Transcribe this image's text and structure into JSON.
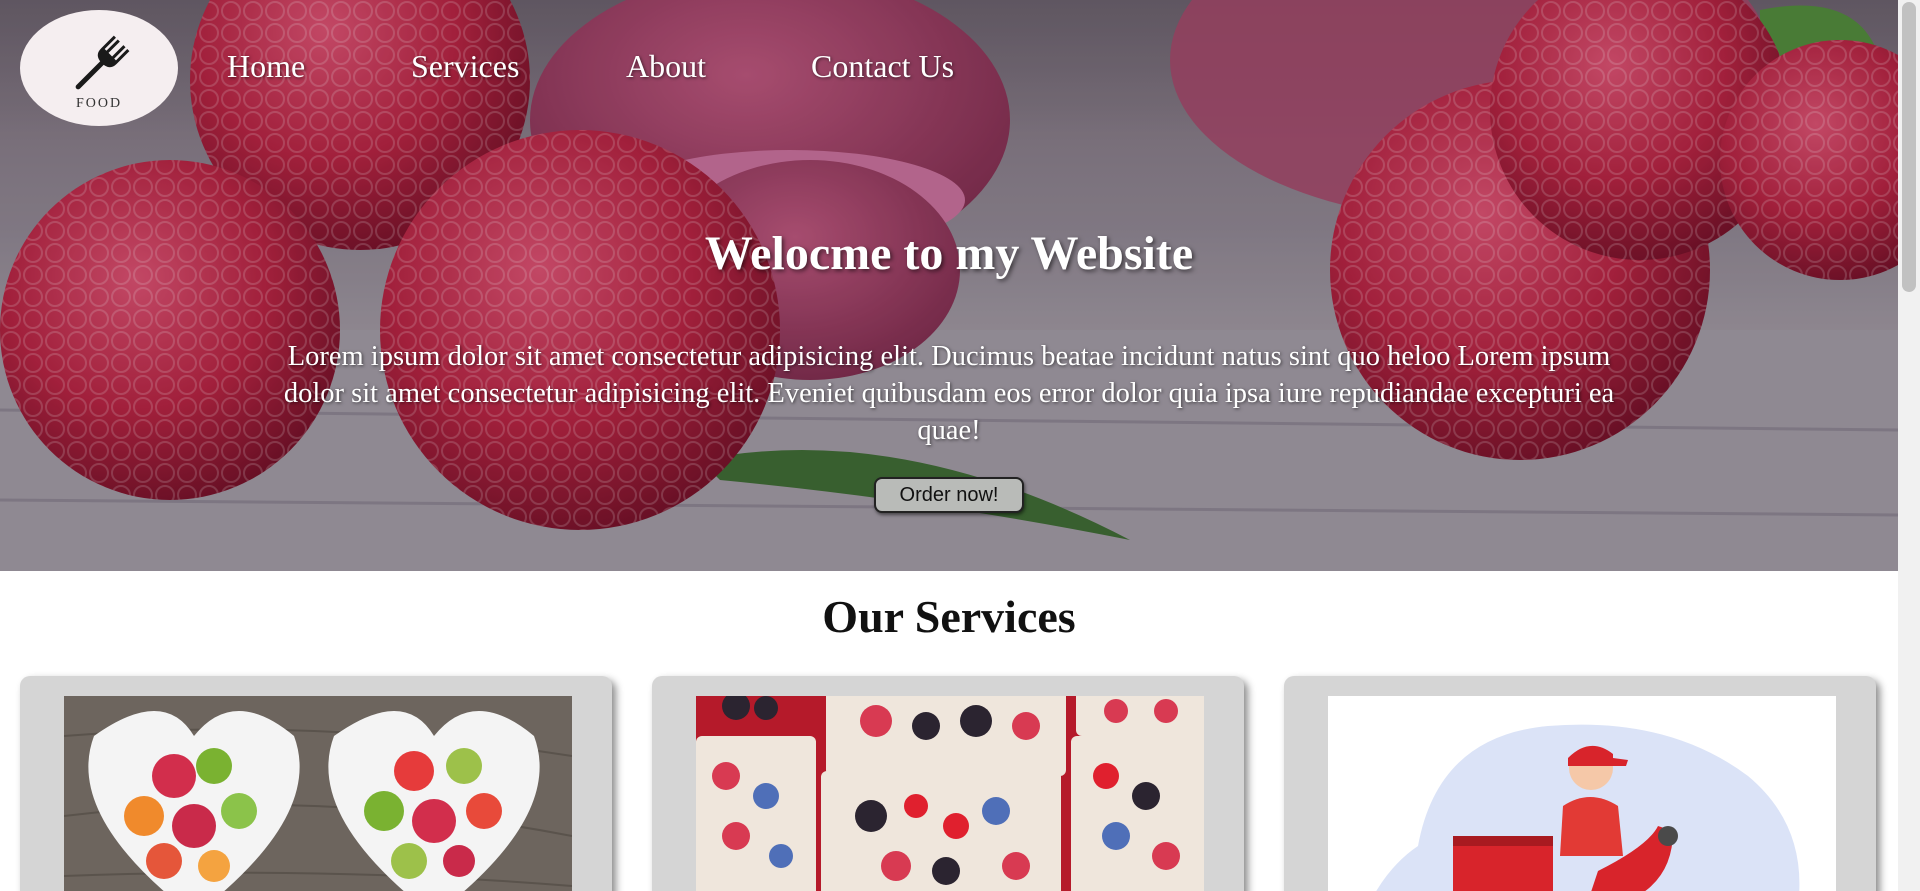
{
  "logo": {
    "text": "FOOD",
    "icon": "fork-icon"
  },
  "nav": {
    "items": [
      {
        "label": "Home"
      },
      {
        "label": "Services"
      },
      {
        "label": "About"
      },
      {
        "label": "Contact Us"
      }
    ]
  },
  "hero": {
    "title": "Welocme to my Website",
    "text": "Lorem ipsum dolor sit amet consectetur adipisicing elit. Ducimus beatae incidunt natus sint quo heloo Lorem ipsum dolor sit amet consectetur adipisicing elit. Eveniet quibusdam eos error dolor quia ipsa iure repudiandae excepturi ea quae!",
    "button_label": "Order now!"
  },
  "services": {
    "title": "Our Services",
    "cards": [
      {
        "image": "fruit-salad-bowls-image"
      },
      {
        "image": "berry-baskets-image"
      },
      {
        "image": "delivery-scooter-image"
      }
    ]
  },
  "colors": {
    "raspberry": "#b8234a",
    "card_bg": "#d5d5d5",
    "button_bg": "#b9bbb8"
  }
}
